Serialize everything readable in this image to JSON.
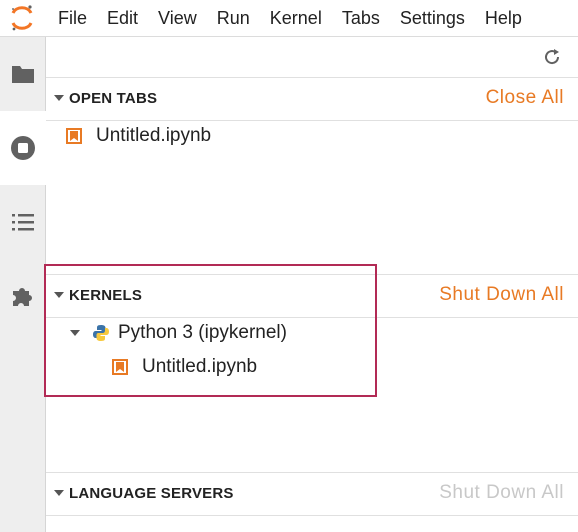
{
  "menubar": {
    "items": [
      "File",
      "Edit",
      "View",
      "Run",
      "Kernel",
      "Tabs",
      "Settings",
      "Help"
    ]
  },
  "activitybar": {
    "items": [
      {
        "icon": "folder-icon"
      },
      {
        "icon": "stop-circle-icon",
        "active": true
      },
      {
        "icon": "list-icon"
      },
      {
        "icon": "puzzle-icon"
      }
    ]
  },
  "open_tabs": {
    "title": "OPEN TABS",
    "action": "Close All",
    "items": [
      "Untitled.ipynb"
    ]
  },
  "kernels": {
    "title": "KERNELS",
    "action": "Shut Down All",
    "kernel_name": "Python 3 (ipykernel)",
    "sessions": [
      "Untitled.ipynb"
    ]
  },
  "language_servers": {
    "title": "LANGUAGE SERVERS",
    "action": "Shut Down All"
  },
  "colors": {
    "accent": "#e87a24",
    "highlight": "#b22a55",
    "disabled": "#c8c8c8"
  }
}
